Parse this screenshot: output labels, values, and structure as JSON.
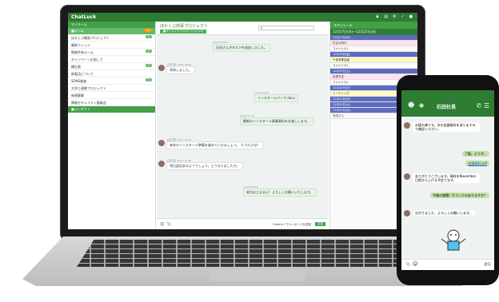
{
  "laptop": {
    "logo": "ChatLuck",
    "sidebar": {
      "header": "マイルーム",
      "section": "■ルーム",
      "section_badge": "11",
      "items": [
        {
          "label": "ほかくぶ開発プロジェクト",
          "badge": "2"
        },
        {
          "label": "最新ナレッジ",
          "badge": ""
        },
        {
          "label": "情報共有ルーム",
          "badge": "9"
        },
        {
          "label": "キャンペーン企画して",
          "badge": ""
        },
        {
          "label": "横企画",
          "badge": "1"
        },
        {
          "label": "新製品について",
          "badge": ""
        },
        {
          "label": "SDNS推進",
          "badge": "1"
        },
        {
          "label": "大学と連携プロジェクト",
          "badge": ""
        },
        {
          "label": "新規事業",
          "badge": ""
        },
        {
          "label": "情報セキュリティ委員会",
          "badge": ""
        }
      ],
      "footer": "■コンタクト"
    },
    "main": {
      "room_name": "ほかくぶ商事プロジェクト",
      "room_tag": "■ルームインフォメーション(3)",
      "search_placeholder": "",
      "messages": [
        {
          "text": "石田さんがタスクを追加しました。",
          "meta": "12/16 15:56"
        },
        {
          "text": "承知しました。",
          "meta": "上田万里 12/16 16:00"
        },
        {
          "text": "インスタールパンフ.docx",
          "meta": "12/16 16:30"
        },
        {
          "text": "最新のインスタール事業資料をお渡しします。",
          "meta": "12/16 17:10"
        },
        {
          "text": "来年のインスタール準備を進めていきましょう。 そうだよね？",
          "meta": "上田万里 12/17 11:45"
        },
        {
          "text": "明日返信あるようでしょう。どうなりましたか。",
          "meta": "上田万里 12/17 11:48"
        },
        {
          "text": "来月はじまるよ！よろしくお願いいたします。",
          "meta": "12/18 10:20"
        }
      ],
      "composer_label": "Enterキーでメッセージを送信",
      "send_label": "送信"
    },
    "right_panel": {
      "header": "スケジュール",
      "calendar_header": "12月17日(木)～12月23日(水)",
      "days": [
        {
          "label": "12月17日(木)",
          "style": "blue"
        },
        {
          "label": "打合せ同行",
          "style": "pink"
        },
        {
          "label": "コメント(1)",
          "style": ""
        },
        {
          "label": "12月18日(金)",
          "style": "blue"
        },
        {
          "label": "午後営業会議",
          "style": "yellow"
        },
        {
          "label": "コメント(2)",
          "style": ""
        },
        {
          "label": "12月19日(土)",
          "style": "blue"
        },
        {
          "label": "出張予定",
          "style": "pink"
        },
        {
          "label": "コメント(3)",
          "style": ""
        },
        {
          "label": "12月20日(日)",
          "style": "blue"
        },
        {
          "label": "ミーティング",
          "style": "yellow"
        },
        {
          "label": "12月21日(月)",
          "style": "blue"
        },
        {
          "label": "12月22日(火)",
          "style": "blue"
        },
        {
          "label": "12月23日(水)",
          "style": "blue"
        },
        {
          "label": "石田さん",
          "style": ""
        }
      ]
    }
  },
  "phone": {
    "title": "石田社長",
    "messages": [
      {
        "text": "お疲れ様です。次の会議資料を送りますので確認ください。",
        "side": "left"
      },
      {
        "text": "了解。どうぞ。",
        "side": "right"
      },
      {
        "text": "会議資料.pdf",
        "side": "link"
      },
      {
        "text": "ありがとうございます。資料をNovember日程から上げる予定でます。",
        "side": "left"
      },
      {
        "text": "今後の課題？そういうのありますか？",
        "side": "right"
      },
      {
        "text": "分かりました、よろしくお願いします。",
        "side": "left"
      }
    ],
    "send_label": "送信"
  },
  "colors": {
    "brand": "#2e7d32",
    "brand_light": "#43a047",
    "background": "#eef2f0"
  }
}
